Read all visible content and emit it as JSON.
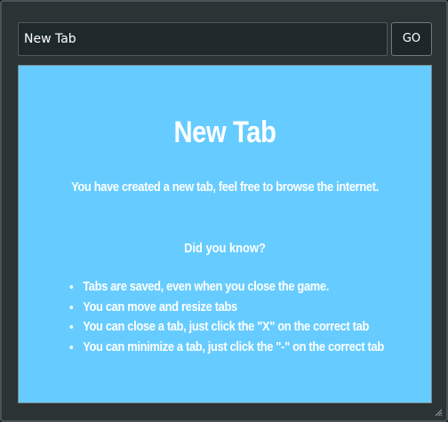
{
  "address_bar": {
    "value": "New Tab",
    "go_label": "GO"
  },
  "page": {
    "title": "New Tab",
    "intro": "You have created a new tab, feel free to browse the internet.",
    "did_you_know": "Did you know?",
    "tips": [
      "Tabs are saved, even when you close the game.",
      "You can move and resize tabs",
      "You can close a tab, just click the \"X\" on the correct tab",
      "You can minimize a tab, just click the \"-\" on the correct tab"
    ]
  },
  "colors": {
    "window_bg": "#2b3335",
    "content_bg": "#66ccff",
    "text": "#ffffff"
  },
  "icons": {
    "resize_grip": "resize-grip-icon"
  }
}
